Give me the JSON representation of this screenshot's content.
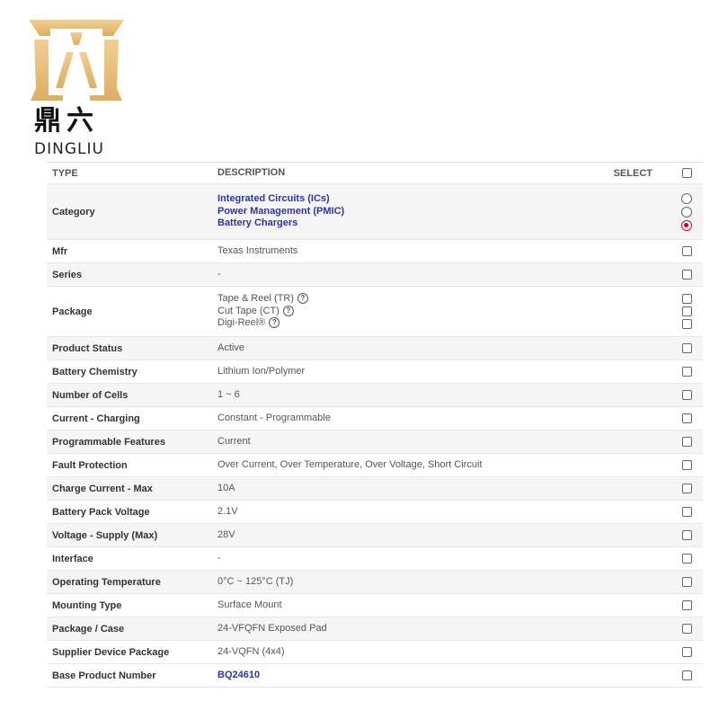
{
  "brand": {
    "name_cn": "鼎六",
    "name_en": "DINGLIU",
    "logo_color": "#e9c07a"
  },
  "table": {
    "header": {
      "type": "TYPE",
      "description": "DESCRIPTION",
      "select": "SELECT"
    },
    "category": {
      "label": "Category",
      "values": [
        "Integrated Circuits (ICs)",
        "Power Management (PMIC)",
        "Battery Chargers"
      ],
      "selected_index": 2
    },
    "mfr": {
      "label": "Mfr",
      "value": "Texas Instruments"
    },
    "series": {
      "label": "Series",
      "value": "-"
    },
    "package": {
      "label": "Package",
      "values": [
        "Tape & Reel (TR)",
        "Cut Tape (CT)",
        "Digi-Reel®"
      ],
      "help_icon": "?"
    },
    "rows": [
      {
        "label": "Product Status",
        "value": "Active"
      },
      {
        "label": "Battery Chemistry",
        "value": "Lithium Ion/Polymer"
      },
      {
        "label": "Number of Cells",
        "value": "1 ~ 6"
      },
      {
        "label": "Current - Charging",
        "value": "Constant - Programmable"
      },
      {
        "label": "Programmable Features",
        "value": "Current"
      },
      {
        "label": "Fault Protection",
        "value": "Over Current, Over Temperature, Over Voltage, Short Circuit"
      },
      {
        "label": "Charge Current - Max",
        "value": "10A"
      },
      {
        "label": "Battery Pack Voltage",
        "value": "2.1V"
      },
      {
        "label": "Voltage - Supply (Max)",
        "value": "28V"
      },
      {
        "label": "Interface",
        "value": "-"
      },
      {
        "label": "Operating Temperature",
        "value": "0°C ~ 125°C (TJ)"
      },
      {
        "label": "Mounting Type",
        "value": "Surface Mount"
      },
      {
        "label": "Package / Case",
        "value": "24-VFQFN Exposed Pad"
      },
      {
        "label": "Supplier Device Package",
        "value": "24-VQFN (4x4)"
      }
    ],
    "base_product": {
      "label": "Base Product Number",
      "value": "BQ24610"
    }
  },
  "colors": {
    "link": "#2b35a8",
    "radio_selected": "#d0021b",
    "row_alt": "#f5f5f5"
  }
}
